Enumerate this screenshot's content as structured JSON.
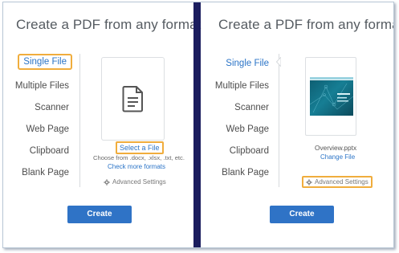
{
  "left": {
    "title": "Create a PDF from any format",
    "sidebar": [
      "Single File",
      "Multiple Files",
      "Scanner",
      "Web Page",
      "Clipboard",
      "Blank Page"
    ],
    "select_file": "Select a File",
    "choose_text": "Choose from .docx, .xlsx, .txt, etc.",
    "more_formats": "Check more formats",
    "advanced": "Advanced Settings",
    "create": "Create"
  },
  "right": {
    "title": "Create a PDF from any format",
    "sidebar": [
      "Single File",
      "Multiple Files",
      "Scanner",
      "Web Page",
      "Clipboard",
      "Blank Page"
    ],
    "file_name": "Overview.pptx",
    "change_file": "Change File",
    "advanced": "Advanced Settings",
    "create": "Create"
  },
  "colors": {
    "accent": "#2b74c7",
    "highlight": "#f0ad3d",
    "divider": "#1b1d5e",
    "button": "#2f73c6"
  }
}
